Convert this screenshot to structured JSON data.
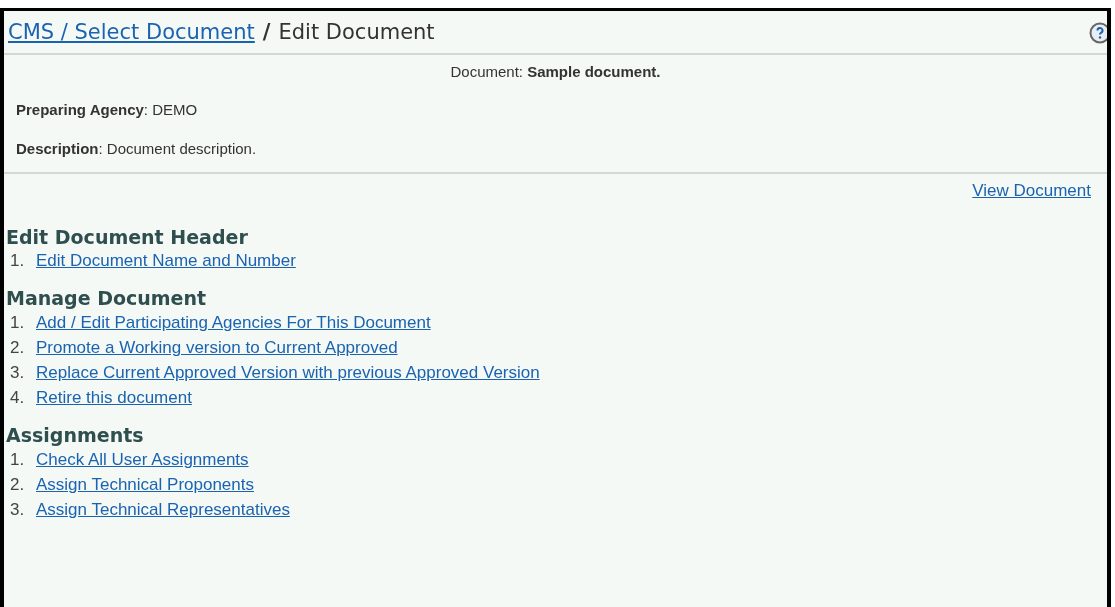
{
  "breadcrumb": {
    "link": "CMS / Select Document",
    "separator": "/",
    "current": "Edit Document"
  },
  "document": {
    "label": "Document:",
    "name": "Sample document."
  },
  "fields": [
    {
      "label": "Preparing Agency",
      "value": ": DEMO"
    },
    {
      "label": "Description",
      "value": ": Document description."
    }
  ],
  "view_link": "View Document",
  "sections": [
    {
      "title": "Edit Document Header",
      "items": [
        {
          "number": "1.",
          "label": "Edit Document Name and Number"
        }
      ]
    },
    {
      "title": "Manage Document",
      "items": [
        {
          "number": "1.",
          "label": "Add / Edit Participating Agencies For This Document"
        },
        {
          "number": "2.",
          "label": "Promote a Working version to Current Approved"
        },
        {
          "number": "3.",
          "label": "Replace Current Approved Version with previous Approved Version"
        },
        {
          "number": "4.",
          "label": "Retire this document"
        }
      ]
    },
    {
      "title": "Assignments",
      "items": [
        {
          "number": "1.",
          "label": "Check All User Assignments"
        },
        {
          "number": "2.",
          "label": "Assign Technical Proponents"
        },
        {
          "number": "3.",
          "label": "Assign Technical Representatives"
        }
      ]
    }
  ]
}
